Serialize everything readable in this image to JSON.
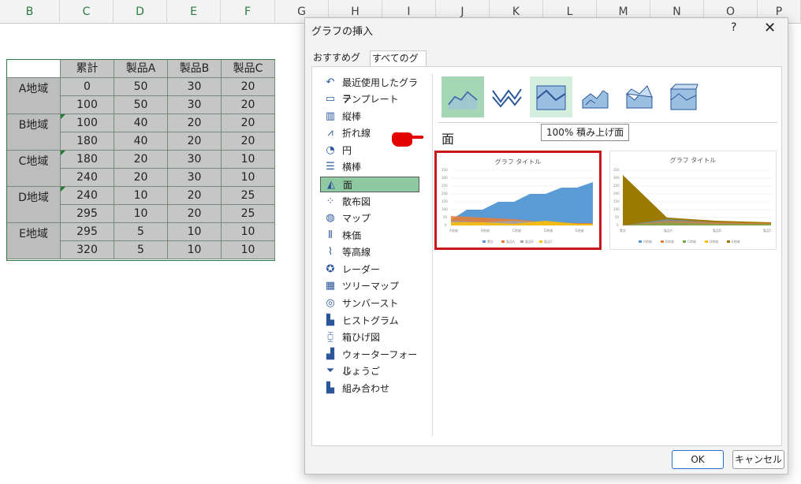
{
  "columns": [
    "B",
    "C",
    "D",
    "E",
    "F",
    "G",
    "H",
    "I",
    "J",
    "K",
    "L",
    "M",
    "N",
    "O",
    "P"
  ],
  "table": {
    "headers": [
      "累計",
      "製品A",
      "製品B",
      "製品C"
    ],
    "regions": [
      "A地域",
      "B地域",
      "C地域",
      "D地域",
      "E地域"
    ],
    "rows": [
      [
        "0",
        "50",
        "30",
        "20"
      ],
      [
        "100",
        "50",
        "30",
        "20"
      ],
      [
        "100",
        "40",
        "20",
        "20"
      ],
      [
        "180",
        "40",
        "20",
        "20"
      ],
      [
        "180",
        "20",
        "30",
        "10"
      ],
      [
        "240",
        "20",
        "30",
        "10"
      ],
      [
        "240",
        "10",
        "20",
        "25"
      ],
      [
        "295",
        "10",
        "20",
        "25"
      ],
      [
        "295",
        "5",
        "10",
        "10"
      ],
      [
        "320",
        "5",
        "10",
        "10"
      ]
    ]
  },
  "dialog": {
    "title": "グラフの挿入",
    "help": "?",
    "close": "✕",
    "tabs": [
      "おすすめグラフ",
      "すべてのグラフ"
    ],
    "chart_types": [
      {
        "label": "最近使用したグラフ",
        "icon": "recent-icon"
      },
      {
        "label": "テンプレート",
        "icon": "template-icon"
      },
      {
        "label": "縦棒",
        "icon": "column-chart-icon"
      },
      {
        "label": "折れ線",
        "icon": "line-chart-icon"
      },
      {
        "label": "円",
        "icon": "pie-chart-icon"
      },
      {
        "label": "横棒",
        "icon": "bar-chart-icon"
      },
      {
        "label": "面",
        "icon": "area-chart-icon"
      },
      {
        "label": "散布図",
        "icon": "scatter-chart-icon"
      },
      {
        "label": "マップ",
        "icon": "map-chart-icon"
      },
      {
        "label": "株価",
        "icon": "stock-chart-icon"
      },
      {
        "label": "等高線",
        "icon": "surface-chart-icon"
      },
      {
        "label": "レーダー",
        "icon": "radar-chart-icon"
      },
      {
        "label": "ツリーマップ",
        "icon": "treemap-chart-icon"
      },
      {
        "label": "サンバースト",
        "icon": "sunburst-chart-icon"
      },
      {
        "label": "ヒストグラム",
        "icon": "histogram-chart-icon"
      },
      {
        "label": "箱ひげ図",
        "icon": "boxplot-chart-icon"
      },
      {
        "label": "ウォーターフォール",
        "icon": "waterfall-chart-icon"
      },
      {
        "label": "じょうご",
        "icon": "funnel-chart-icon"
      },
      {
        "label": "組み合わせ",
        "icon": "combo-chart-icon"
      }
    ],
    "selected_type": "面",
    "section_heading": "面",
    "tooltip": "100% 積み上げ面",
    "preview_title": "グラフ タイトル",
    "preview1_categories": [
      "A地域",
      "B地域",
      "C地域",
      "D地域",
      "E地域"
    ],
    "preview1_legend": [
      "累計",
      "製品A",
      "製品B",
      "製品C"
    ],
    "preview2_categories": [
      "累計",
      "製品A",
      "製品B",
      "製品C"
    ],
    "preview2_legend": [
      "A地域",
      "B地域",
      "C地域",
      "D地域",
      "E地域"
    ],
    "y_ticks": [
      "350",
      "300",
      "250",
      "200",
      "150",
      "100",
      "50",
      "0"
    ],
    "ok": "OK",
    "cancel": "キャンセル"
  },
  "colors": {
    "accent_green": "#217346",
    "selection": "#8fc9a1",
    "highlight_red": "#c8181b",
    "series_blue": "#5b9bd5",
    "series_orange": "#ed7d31",
    "series_gray": "#a5a5a5",
    "series_yellow": "#ffc000",
    "olive": "#9c7a00"
  }
}
